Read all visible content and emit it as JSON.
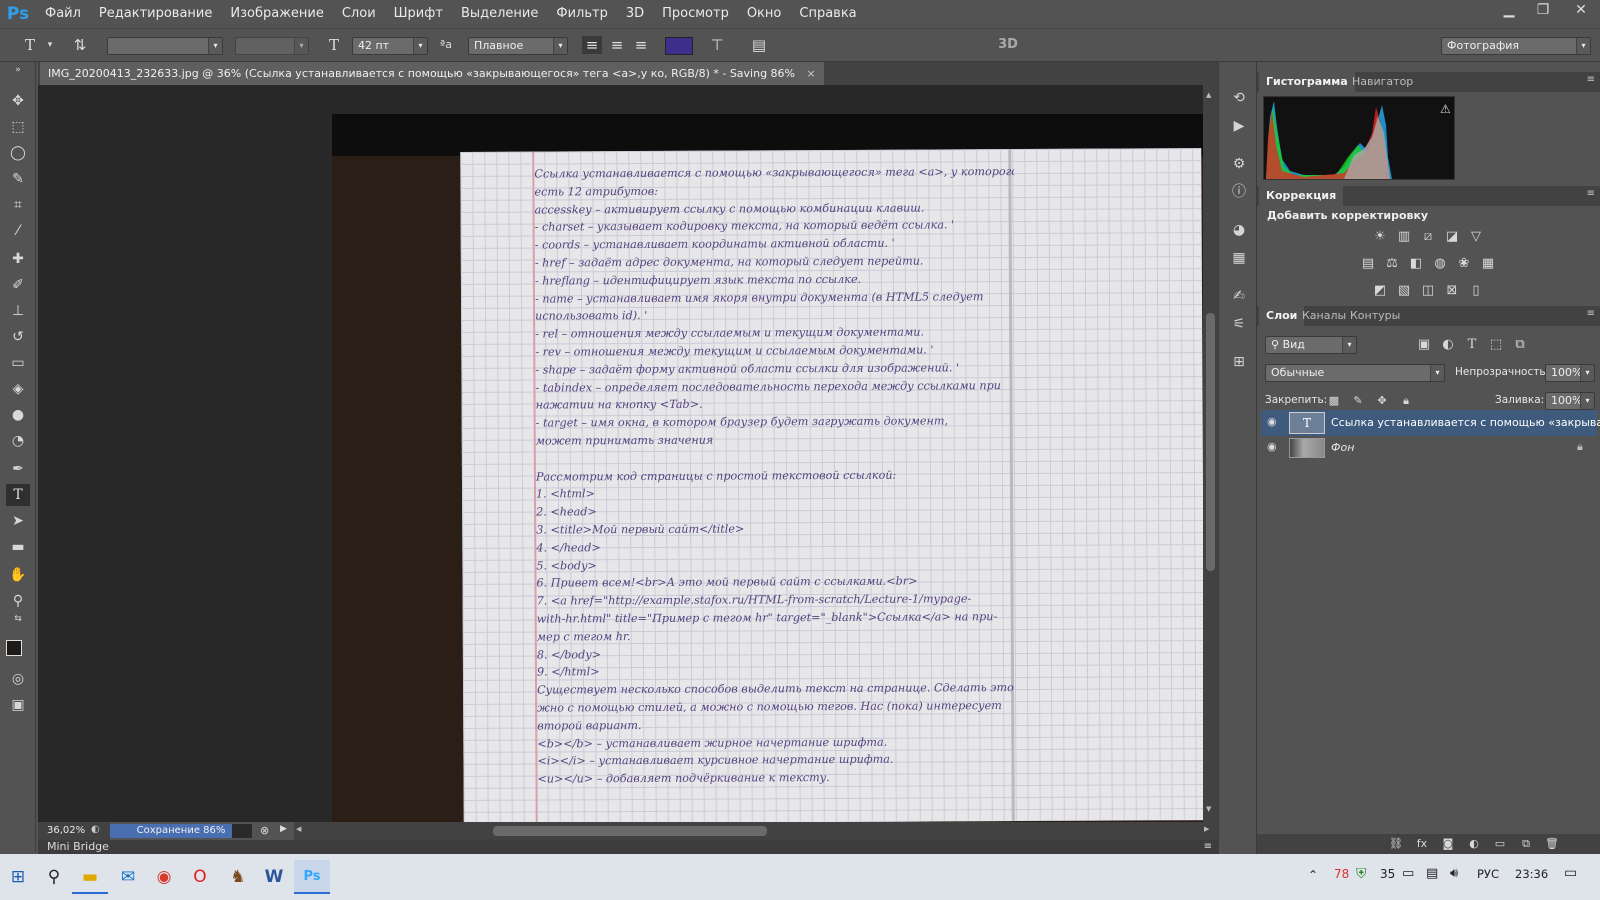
{
  "app": {
    "logo": "Ps"
  },
  "menu": [
    "Файл",
    "Редактирование",
    "Изображение",
    "Слои",
    "Шрифт",
    "Выделение",
    "Фильтр",
    "3D",
    "Просмотр",
    "Окно",
    "Справка"
  ],
  "window_controls": {
    "minimize": "▁",
    "restore": "❐",
    "close": "✕"
  },
  "options": {
    "font_size": "42 пт",
    "aa_label": "ªa",
    "antialias": "Плавное",
    "mode_3d": "3D",
    "workspace": "Фотография",
    "text_color": "#3e2f8c"
  },
  "document": {
    "tab_title": "IMG_20200413_232633.jpg @ 36% (Ссылка устанавливается с помощью «закрывающегося» тега <a>,у ко, RGB/8) * - Saving 86%",
    "close": "×"
  },
  "handwriting": [
    "Ссылка устанавливается с помощью «закрывающегося» тега <a>, у которого",
    " есть 12 атрибутов:",
    "accesskey – активирует ссылку с помощью комбинации клавиш.",
    " - charset – указывает кодировку текста, на который ведёт ссылка. '",
    " - coords – устанавливает координаты активной области. '",
    "  - href – задаёт адрес документа, на который следует перейти.",
    "  - hreflang – идентифицирует язык текста по ссылке.",
    "  - name – устанавливает имя якоря внутри документа (в HTML5 следует",
    "использовать id). '",
    "  - rel – отношения между ссылаемым и текущим документами.",
    "  - rev – отношения между текущим и ссылаемым документами. '",
    "  - shape – задаёт форму активной области ссылки для изображений. '",
    "  - tabindex – определяет последовательность перехода между ссылками при",
    "нажатии на кнопку <Tab>.",
    "  - target – имя окна, в котором браузер будет загружать документ,",
    "может принимать значения",
    "",
    "Рассмотрим код страницы с простой текстовой ссылкой:",
    "1. <html>",
    "2. <head>",
    " 3. <title>Мой первый сайт</title>",
    "4. </head>",
    "5. <body>",
    "6. Привет всем!<br>А это мой первый сайт с ссылками.<br>",
    " 7. <a href=\"http://example.stafox.ru/HTML-from-scratch/Lecture-1/mypage-",
    "with-hr.html\" title=\"Пример с тегом hr\" target=\"_blank\">Ссылка</a> на при-",
    "мер с тегом hr.",
    " 8. </body>",
    "9. </html>",
    "Существует несколько способов выделить текст на странице. Сделать это мо-",
    "жно с помощью стилей, а можно с помощью тегов. Нас (пока) интересует",
    " второй вариант.",
    " <b></b> – устанавливает жирное начертание шрифта.",
    " <i></i> – устанавливает курсивное начертание шрифта.",
    " <u></u> – добавляет подчёркивание к тексту."
  ],
  "status": {
    "zoom": "36,02%",
    "progress_label": "Сохранение 86%",
    "progress": 0.86
  },
  "minibridge": "Mini Bridge",
  "panels": {
    "histogram_tabs": [
      "Гистограмма",
      "Навигатор"
    ],
    "correction_tab": "Коррекция",
    "add_adjustment": "Добавить корректировку",
    "layers_tabs": [
      "Слои",
      "Каналы",
      "Контуры"
    ],
    "filter_kind": "Вид",
    "blend_mode": "Обычные",
    "opacity_label": "Непрозрачность:",
    "opacity": "100%",
    "lock_label": "Закрепить:",
    "fill_label": "Заливка:",
    "fill": "100%",
    "layers": [
      {
        "name": "Ссылка устанавливается с помощью «закрыва...",
        "thumb": "T"
      },
      {
        "name": "Фон"
      }
    ]
  },
  "taskbar": {
    "time": "23:36",
    "lang": "РУС",
    "badge1": "78",
    "badge2": "35"
  }
}
